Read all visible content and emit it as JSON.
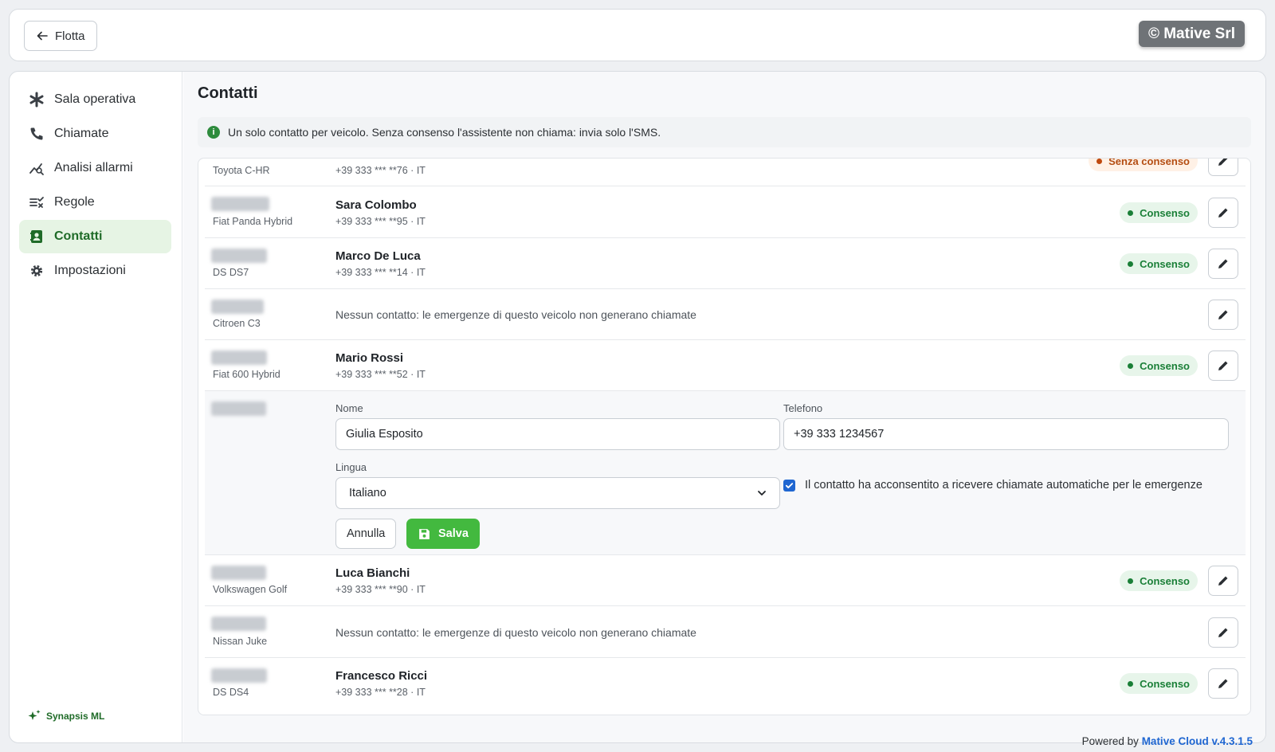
{
  "topbar": {
    "back_label": "Flotta",
    "brand": "© Mative Srl"
  },
  "sidebar": {
    "items": [
      {
        "label": "Sala operativa",
        "icon": "asterisk-icon"
      },
      {
        "label": "Chiamate",
        "icon": "phone-icon"
      },
      {
        "label": "Analisi allarmi",
        "icon": "analytics-icon"
      },
      {
        "label": "Regole",
        "icon": "rules-icon"
      },
      {
        "label": "Contatti",
        "icon": "contacts-icon",
        "active": true
      },
      {
        "label": "Impostazioni",
        "icon": "gear-icon"
      }
    ],
    "footer": "Synapsis ML"
  },
  "main": {
    "title": "Contatti",
    "info": "Un solo contatto per veicolo. Senza consenso l'assistente non chiama: invia solo l'SMS."
  },
  "rows": [
    {
      "model": "Toyota C-HR",
      "phone": "+39 333 *** **76 · IT",
      "status": "Senza consenso"
    },
    {
      "model": "Fiat Panda Hybrid",
      "name": "Sara Colombo",
      "phone": "+39 333 *** **95 · IT",
      "status": "Consenso"
    },
    {
      "model": "DS DS7",
      "name": "Marco De Luca",
      "phone": "+39 333 *** **14 · IT",
      "status": "Consenso"
    },
    {
      "model": "Citroen C3",
      "empty": "Nessun contatto: le emergenze di questo veicolo non generano chiamate"
    },
    {
      "model": "Fiat 600 Hybrid",
      "name": "Mario Rossi",
      "phone": "+39 333 *** **52 · IT",
      "status": "Consenso"
    },
    {
      "model": "Volkswagen Golf",
      "name": "Luca Bianchi",
      "phone": "+39 333 *** **90 · IT",
      "status": "Consenso"
    },
    {
      "model": "Nissan Juke",
      "empty": "Nessun contatto: le emergenze di questo veicolo non generano chiamate"
    },
    {
      "model": "DS DS4",
      "name": "Francesco Ricci",
      "phone": "+39 333 *** **28 · IT",
      "status": "Consenso"
    }
  ],
  "edit_form": {
    "name_label": "Nome",
    "name_value": "Giulia Esposito",
    "phone_label": "Telefono",
    "phone_value": "+39 333 1234567",
    "language_label": "Lingua",
    "language_value": "Italiano",
    "consent_label": "Il contatto ha acconsentito a ricevere chiamate automatiche per le emergenze",
    "consent_checked": true,
    "cancel_label": "Annulla",
    "save_label": "Salva"
  },
  "footer": {
    "powered_prefix": "Powered by",
    "powered_brand": "Mative Cloud v.4.3.1.5"
  },
  "colors": {
    "accent_green": "#43b93f",
    "consent_green": "#1a7f37",
    "warning_orange": "#c0490e",
    "link_blue": "#1f66d1"
  }
}
